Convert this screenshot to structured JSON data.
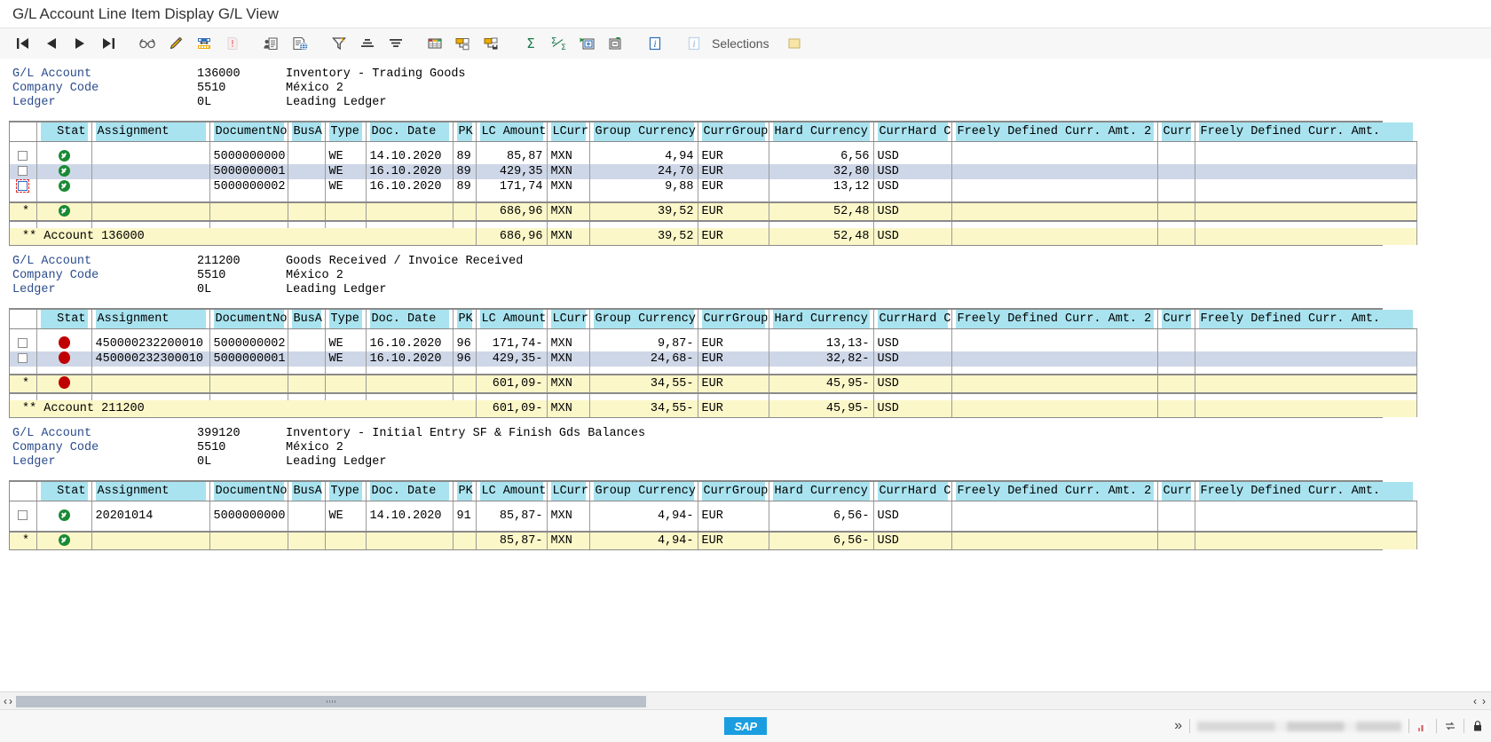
{
  "window": {
    "title": "G/L Account Line Item Display G/L View"
  },
  "toolbar": {
    "items": [
      {
        "name": "first-page-button",
        "icon": "first-page-icon",
        "label": "First Page"
      },
      {
        "name": "previous-page-button",
        "icon": "previous-page-icon",
        "label": "Previous Page"
      },
      {
        "name": "next-page-button",
        "icon": "next-page-icon",
        "label": "Next Page"
      },
      {
        "name": "last-page-button",
        "icon": "last-page-icon",
        "label": "Last Page"
      },
      {
        "name": "display-document-button",
        "icon": "glasses-icon",
        "label": "Display Document"
      },
      {
        "name": "change-document-button",
        "icon": "pencil-icon",
        "label": "Change Document"
      },
      {
        "name": "change-layout-button",
        "icon": "layout-icon",
        "label": "Change Layout"
      },
      {
        "name": "select-layout-button",
        "icon": "page-red-icon",
        "label": "Select Layout"
      },
      {
        "name": "master-record-button",
        "icon": "master-record-icon",
        "label": "Master Record"
      },
      {
        "name": "document-web-button",
        "icon": "document-web-icon",
        "label": "Document Overview"
      },
      {
        "name": "filter-button",
        "icon": "filter-icon",
        "label": "Set Filter"
      },
      {
        "name": "sort-ascending-button",
        "icon": "sort-ascending-icon",
        "label": "Sort in Ascending Order"
      },
      {
        "name": "sort-descending-button",
        "icon": "sort-descending-icon",
        "label": "Sort in Descending Order"
      },
      {
        "name": "spreadsheet-button",
        "icon": "spreadsheet-icon",
        "label": "Spreadsheet"
      },
      {
        "name": "export-button",
        "icon": "export-icon",
        "label": "Export"
      },
      {
        "name": "send-button",
        "icon": "send-save-icon",
        "label": "Save / Send"
      },
      {
        "name": "total-button",
        "icon": "sigma-icon",
        "label": "Total"
      },
      {
        "name": "subtotal-button",
        "icon": "sigma-fraction-icon",
        "label": "Subtotals"
      },
      {
        "name": "expand-all-button",
        "icon": "expand-plus-icon",
        "label": "Expand All"
      },
      {
        "name": "collapse-all-button",
        "icon": "collapse-minus-icon",
        "label": "Collapse All"
      },
      {
        "name": "info-button",
        "icon": "info-icon",
        "label": "Information"
      },
      {
        "name": "selections-button",
        "icon": "info-grey-icon",
        "label": "Selections"
      }
    ],
    "selections_label": "Selections"
  },
  "labels": {
    "gl_account": "G/L Account",
    "company_code": "Company Code",
    "ledger": "Ledger"
  },
  "columns": [
    {
      "key": "sel",
      "label": "",
      "cls": "c-sel",
      "align": "ctr"
    },
    {
      "key": "stat",
      "label": "Stat",
      "cls": "c-stat",
      "align": "num"
    },
    {
      "key": "assign",
      "label": "Assignment",
      "cls": "c-assign",
      "align": "left"
    },
    {
      "key": "docno",
      "label": "DocumentNo",
      "cls": "c-docno",
      "align": "left"
    },
    {
      "key": "busa",
      "label": "BusA",
      "cls": "c-busa",
      "align": "left"
    },
    {
      "key": "type",
      "label": "Type",
      "cls": "c-type",
      "align": "left"
    },
    {
      "key": "date",
      "label": "Doc. Date",
      "cls": "c-date",
      "align": "left"
    },
    {
      "key": "pk",
      "label": "PK",
      "cls": "c-pk",
      "align": "left"
    },
    {
      "key": "lcamt",
      "label": "LC Amount",
      "cls": "c-lcamt",
      "align": "num"
    },
    {
      "key": "lcurr",
      "label": "LCurr",
      "cls": "c-lcurr",
      "align": "left"
    },
    {
      "key": "grpcur",
      "label": "Group Currency",
      "cls": "c-grpcur",
      "align": "num"
    },
    {
      "key": "currgrp",
      "label": "CurrGroup",
      "cls": "c-currgrp",
      "align": "left"
    },
    {
      "key": "hardcur",
      "label": "Hard Currency",
      "cls": "c-hardcur",
      "align": "num"
    },
    {
      "key": "currhard",
      "label": "CurrHard C",
      "cls": "c-currhard",
      "align": "left"
    },
    {
      "key": "free2",
      "label": "Freely Defined Curr. Amt. 2",
      "cls": "c-free2",
      "align": "left"
    },
    {
      "key": "curr",
      "label": "Curr",
      "cls": "c-curr",
      "align": "left"
    },
    {
      "key": "free",
      "label": "Freely Defined Curr. Amt.",
      "cls": "c-free",
      "align": "left"
    }
  ],
  "sections": [
    {
      "gl_account_value": "136000",
      "gl_account_text": "Inventory - Trading Goods",
      "company_code_value": "5510",
      "company_code_text": "México 2",
      "ledger_value": "0L",
      "ledger_text": "Leading Ledger",
      "rows": [
        {
          "status": "ok",
          "checked": false,
          "focus": false,
          "assign": "",
          "docno": "5000000000",
          "busa": "",
          "type": "WE",
          "date": "14.10.2020",
          "pk": "89",
          "lcamt": "85,87",
          "lcurr": "MXN",
          "grpcur": "4,94",
          "currgrp": "EUR",
          "hardcur": "6,56",
          "currhard": "USD",
          "free2": "",
          "curr": "",
          "free": ""
        },
        {
          "status": "ok",
          "checked": false,
          "focus": false,
          "assign": "",
          "docno": "5000000001",
          "busa": "",
          "type": "WE",
          "date": "16.10.2020",
          "pk": "89",
          "lcamt": "429,35",
          "lcurr": "MXN",
          "grpcur": "24,70",
          "currgrp": "EUR",
          "hardcur": "32,80",
          "currhard": "USD",
          "free2": "",
          "curr": "",
          "free": ""
        },
        {
          "status": "ok",
          "checked": false,
          "focus": true,
          "assign": "",
          "docno": "5000000002",
          "busa": "",
          "type": "WE",
          "date": "16.10.2020",
          "pk": "89",
          "lcamt": "171,74",
          "lcurr": "MXN",
          "grpcur": "9,88",
          "currgrp": "EUR",
          "hardcur": "13,12",
          "currhard": "USD",
          "free2": "",
          "curr": "",
          "free": ""
        }
      ],
      "subtotal": {
        "marker": "*",
        "status": "ok",
        "lcamt": "686,96",
        "lcurr": "MXN",
        "grpcur": "39,52",
        "currgrp": "EUR",
        "hardcur": "52,48",
        "currhard": "USD"
      },
      "total": {
        "label": "** Account 136000",
        "lcamt": "686,96",
        "lcurr": "MXN",
        "grpcur": "39,52",
        "currgrp": "EUR",
        "hardcur": "52,48",
        "currhard": "USD"
      }
    },
    {
      "gl_account_value": "211200",
      "gl_account_text": "Goods Received / Invoice Received",
      "company_code_value": "5510",
      "company_code_text": "México 2",
      "ledger_value": "0L",
      "ledger_text": "Leading Ledger",
      "rows": [
        {
          "status": "err",
          "checked": false,
          "focus": false,
          "assign": "450000232200010",
          "docno": "5000000002",
          "busa": "",
          "type": "WE",
          "date": "16.10.2020",
          "pk": "96",
          "lcamt": "171,74-",
          "lcurr": "MXN",
          "grpcur": "9,87-",
          "currgrp": "EUR",
          "hardcur": "13,13-",
          "currhard": "USD",
          "free2": "",
          "curr": "",
          "free": ""
        },
        {
          "status": "err",
          "checked": false,
          "focus": false,
          "assign": "450000232300010",
          "docno": "5000000001",
          "busa": "",
          "type": "WE",
          "date": "16.10.2020",
          "pk": "96",
          "lcamt": "429,35-",
          "lcurr": "MXN",
          "grpcur": "24,68-",
          "currgrp": "EUR",
          "hardcur": "32,82-",
          "currhard": "USD",
          "free2": "",
          "curr": "",
          "free": ""
        }
      ],
      "subtotal": {
        "marker": "*",
        "status": "err",
        "lcamt": "601,09-",
        "lcurr": "MXN",
        "grpcur": "34,55-",
        "currgrp": "EUR",
        "hardcur": "45,95-",
        "currhard": "USD"
      },
      "total": {
        "label": "** Account 211200",
        "lcamt": "601,09-",
        "lcurr": "MXN",
        "grpcur": "34,55-",
        "currgrp": "EUR",
        "hardcur": "45,95-",
        "currhard": "USD"
      }
    },
    {
      "gl_account_value": "399120",
      "gl_account_text": "Inventory - Initial Entry SF & Finish Gds Balances",
      "company_code_value": "5510",
      "company_code_text": "México 2",
      "ledger_value": "0L",
      "ledger_text": "Leading Ledger",
      "rows": [
        {
          "status": "ok",
          "checked": false,
          "focus": false,
          "assign": "20201014",
          "docno": "5000000000",
          "busa": "",
          "type": "WE",
          "date": "14.10.2020",
          "pk": "91",
          "lcamt": "85,87-",
          "lcurr": "MXN",
          "grpcur": "4,94-",
          "currgrp": "EUR",
          "hardcur": "6,56-",
          "currhard": "USD",
          "free2": "",
          "curr": "",
          "free": ""
        }
      ],
      "subtotal": {
        "marker": "*",
        "status": "ok",
        "lcamt": "85,87-",
        "lcurr": "MXN",
        "grpcur": "4,94-",
        "currgrp": "EUR",
        "hardcur": "6,56-",
        "currhard": "USD"
      },
      "total": null
    }
  ],
  "scrollbar": {
    "left_arrow": "‹",
    "right_arrow": "›",
    "end_left_arrow": "‹",
    "end_right_arrow": "›"
  },
  "statusbar": {
    "logo": "SAP",
    "chevron": "»"
  },
  "colors": {
    "header_highlight": "#a9e3ef",
    "alt_row": "#ced7e7",
    "subtotal": "#fbf7c8",
    "status_ok": "#1a8a34",
    "status_error": "#c00000",
    "link_label": "#2b4c8c",
    "sap_blue": "#1a9ee0",
    "focus_outline": "#e03030"
  }
}
